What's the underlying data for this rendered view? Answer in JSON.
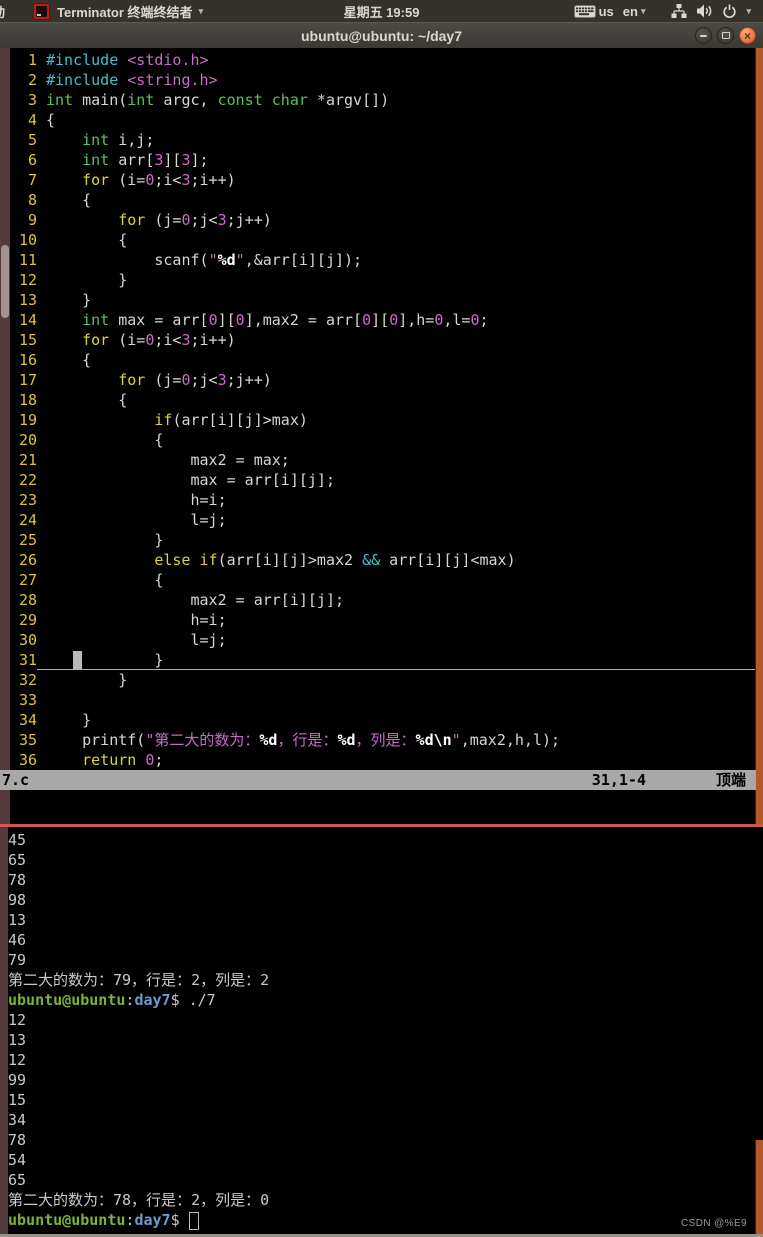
{
  "colors": {
    "panel_bg": "#35322b",
    "panel_text": "#dcd8cf",
    "titlebar_top": "#4c4a45",
    "titlebar_bottom": "#3b3935",
    "titlebar_text": "#dcd8cf",
    "term_bg": "#000000",
    "linenr": "#dcc535",
    "keyword": "#d8d33f",
    "type": "#52c45c",
    "preproc": "#3fc1cf",
    "string": "#c96bc8",
    "special": "#ffffff",
    "operator_cyan": "#3fc8c8",
    "plain": "#d6d6d6",
    "statusbar_bg": "#a8a8a8",
    "statusbar_text": "#000000",
    "cursor": "#b9b9b9",
    "divider_red": "#cf574d",
    "scroll_track": "#543a3c",
    "scroll_thumb_light": "#a29294",
    "scroll_thumb_orange": "#b5562c",
    "prompt_user": "#7cb335",
    "prompt_dir": "#6b9bd2",
    "output_text": "#c9c9c9",
    "watermark": "#9a9a9a"
  },
  "top_bar": {
    "clipped_text": "动",
    "app_menu": "Terminator 终端终结者",
    "menu_caret": "▾",
    "clock": "星期五 19:59",
    "keyboard_label": "us",
    "language_label": "en",
    "language_caret": "▾",
    "session_caret": "▾",
    "icons": [
      "keyboard-icon",
      "network-icon",
      "volume-icon",
      "power-icon"
    ]
  },
  "title_bar": {
    "title": "ubuntu@ubuntu: ~/day7",
    "close_glyph": "×"
  },
  "editor": {
    "status": {
      "file": "7.c",
      "ruler": "31,1-4",
      "position": "顶端"
    },
    "lines": [
      {
        "n": "1",
        "s": [
          [
            "pre",
            "#include"
          ],
          [
            "pl",
            " "
          ],
          [
            "str",
            "<stdio.h>"
          ]
        ]
      },
      {
        "n": "2",
        "s": [
          [
            "pre",
            "#include"
          ],
          [
            "pl",
            " "
          ],
          [
            "str",
            "<string.h>"
          ]
        ]
      },
      {
        "n": "3",
        "s": [
          [
            "typ",
            "int"
          ],
          [
            "pl",
            " main("
          ],
          [
            "typ",
            "int"
          ],
          [
            "pl",
            " argc, "
          ],
          [
            "typ",
            "const"
          ],
          [
            "pl",
            " "
          ],
          [
            "typ",
            "char"
          ],
          [
            "pl",
            " *argv[])"
          ]
        ]
      },
      {
        "n": "4",
        "s": [
          [
            "pl",
            "{"
          ]
        ]
      },
      {
        "n": "5",
        "s": [
          [
            "pl",
            "    "
          ],
          [
            "typ",
            "int"
          ],
          [
            "pl",
            " i,j;"
          ]
        ]
      },
      {
        "n": "6",
        "s": [
          [
            "pl",
            "    "
          ],
          [
            "typ",
            "int"
          ],
          [
            "pl",
            " arr["
          ],
          [
            "str",
            "3"
          ],
          [
            "pl",
            "]["
          ],
          [
            "str",
            "3"
          ],
          [
            "pl",
            "];"
          ]
        ]
      },
      {
        "n": "7",
        "s": [
          [
            "pl",
            "    "
          ],
          [
            "kw",
            "for"
          ],
          [
            "pl",
            " (i="
          ],
          [
            "str",
            "0"
          ],
          [
            "pl",
            ";i<"
          ],
          [
            "str",
            "3"
          ],
          [
            "pl",
            ";i++)"
          ]
        ]
      },
      {
        "n": "8",
        "s": [
          [
            "pl",
            "    {"
          ]
        ]
      },
      {
        "n": "9",
        "s": [
          [
            "pl",
            "        "
          ],
          [
            "kw",
            "for"
          ],
          [
            "pl",
            " (j="
          ],
          [
            "str",
            "0"
          ],
          [
            "pl",
            ";j<"
          ],
          [
            "str",
            "3"
          ],
          [
            "pl",
            ";j++)"
          ]
        ]
      },
      {
        "n": "10",
        "s": [
          [
            "pl",
            "        {"
          ]
        ]
      },
      {
        "n": "11",
        "s": [
          [
            "pl",
            "            scanf("
          ],
          [
            "str",
            "\""
          ],
          [
            "sp",
            "%d"
          ],
          [
            "str",
            "\""
          ],
          [
            "pl",
            ",&arr[i][j]);"
          ]
        ]
      },
      {
        "n": "12",
        "s": [
          [
            "pl",
            "        }"
          ]
        ]
      },
      {
        "n": "13",
        "s": [
          [
            "pl",
            "    }"
          ]
        ]
      },
      {
        "n": "14",
        "s": [
          [
            "pl",
            "    "
          ],
          [
            "typ",
            "int"
          ],
          [
            "pl",
            " max = arr["
          ],
          [
            "str",
            "0"
          ],
          [
            "pl",
            "]["
          ],
          [
            "str",
            "0"
          ],
          [
            "pl",
            "],max2 = arr["
          ],
          [
            "str",
            "0"
          ],
          [
            "pl",
            "]["
          ],
          [
            "str",
            "0"
          ],
          [
            "pl",
            "],h="
          ],
          [
            "str",
            "0"
          ],
          [
            "pl",
            ",l="
          ],
          [
            "str",
            "0"
          ],
          [
            "pl",
            ";"
          ]
        ]
      },
      {
        "n": "15",
        "s": [
          [
            "pl",
            "    "
          ],
          [
            "kw",
            "for"
          ],
          [
            "pl",
            " (i="
          ],
          [
            "str",
            "0"
          ],
          [
            "pl",
            ";i<"
          ],
          [
            "str",
            "3"
          ],
          [
            "pl",
            ";i++)"
          ]
        ]
      },
      {
        "n": "16",
        "s": [
          [
            "pl",
            "    {"
          ]
        ]
      },
      {
        "n": "17",
        "s": [
          [
            "pl",
            "        "
          ],
          [
            "kw",
            "for"
          ],
          [
            "pl",
            " (j="
          ],
          [
            "str",
            "0"
          ],
          [
            "pl",
            ";j<"
          ],
          [
            "str",
            "3"
          ],
          [
            "pl",
            ";j++)"
          ]
        ]
      },
      {
        "n": "18",
        "s": [
          [
            "pl",
            "        {"
          ]
        ]
      },
      {
        "n": "19",
        "s": [
          [
            "pl",
            "            "
          ],
          [
            "kw",
            "if"
          ],
          [
            "pl",
            "(arr[i][j]>max)"
          ]
        ]
      },
      {
        "n": "20",
        "s": [
          [
            "pl",
            "            {"
          ]
        ]
      },
      {
        "n": "21",
        "s": [
          [
            "pl",
            "                max2 = max;"
          ]
        ]
      },
      {
        "n": "22",
        "s": [
          [
            "pl",
            "                max = arr[i][j];"
          ]
        ]
      },
      {
        "n": "23",
        "s": [
          [
            "pl",
            "                h=i;"
          ]
        ]
      },
      {
        "n": "24",
        "s": [
          [
            "pl",
            "                l=j;"
          ]
        ]
      },
      {
        "n": "25",
        "s": [
          [
            "pl",
            "            }"
          ]
        ]
      },
      {
        "n": "26",
        "s": [
          [
            "pl",
            "            "
          ],
          [
            "kw",
            "else"
          ],
          [
            "pl",
            " "
          ],
          [
            "kw",
            "if"
          ],
          [
            "pl",
            "(arr[i][j]>max2 "
          ],
          [
            "opc",
            "&&"
          ],
          [
            "pl",
            " arr[i][j]<max)"
          ]
        ]
      },
      {
        "n": "27",
        "s": [
          [
            "pl",
            "            {"
          ]
        ]
      },
      {
        "n": "28",
        "s": [
          [
            "pl",
            "                max2 = arr[i][j];"
          ]
        ]
      },
      {
        "n": "29",
        "s": [
          [
            "pl",
            "                h=i;"
          ]
        ]
      },
      {
        "n": "30",
        "s": [
          [
            "pl",
            "                l=j;"
          ]
        ]
      },
      {
        "n": "31",
        "cls": "cursorline",
        "s": [
          [
            "pl",
            "   "
          ],
          [
            "cur",
            " "
          ],
          [
            "pl",
            "        }"
          ]
        ]
      },
      {
        "n": "32",
        "s": [
          [
            "pl",
            "        }"
          ]
        ]
      },
      {
        "n": "33",
        "s": []
      },
      {
        "n": "34",
        "s": [
          [
            "pl",
            "    }"
          ]
        ]
      },
      {
        "n": "35",
        "s": [
          [
            "pl",
            "    printf("
          ],
          [
            "str",
            "\"第二大的数为："
          ],
          [
            "sp",
            "%d"
          ],
          [
            "str",
            "，行是："
          ],
          [
            "sp",
            "%d"
          ],
          [
            "str",
            "，列是："
          ],
          [
            "sp",
            "%d"
          ],
          [
            "sp",
            "\\n"
          ],
          [
            "str",
            "\""
          ],
          [
            "pl",
            ",max2,h,l);"
          ]
        ]
      },
      {
        "n": "36",
        "s": [
          [
            "pl",
            "    "
          ],
          [
            "kw",
            "return"
          ],
          [
            "pl",
            " "
          ],
          [
            "str",
            "0"
          ],
          [
            "pl",
            ";"
          ]
        ]
      }
    ]
  },
  "terminal": {
    "lines": [
      {
        "s": [
          [
            "out",
            "45"
          ]
        ]
      },
      {
        "s": [
          [
            "out",
            "65"
          ]
        ]
      },
      {
        "s": [
          [
            "out",
            "78"
          ]
        ]
      },
      {
        "s": [
          [
            "out",
            "98"
          ]
        ]
      },
      {
        "s": [
          [
            "out",
            "13"
          ]
        ]
      },
      {
        "s": [
          [
            "out",
            "46"
          ]
        ]
      },
      {
        "s": [
          [
            "out",
            "79"
          ]
        ]
      },
      {
        "s": [
          [
            "out",
            "第二大的数为：79，行是：2，列是：2"
          ]
        ]
      },
      {
        "s": [
          [
            "g",
            "ubuntu@ubuntu"
          ],
          [
            "out",
            ":"
          ],
          [
            "b",
            "day7"
          ],
          [
            "out",
            "$ ./7"
          ]
        ]
      },
      {
        "s": [
          [
            "out",
            "12"
          ]
        ]
      },
      {
        "s": [
          [
            "out",
            "13"
          ]
        ]
      },
      {
        "s": [
          [
            "out",
            "12"
          ]
        ]
      },
      {
        "s": [
          [
            "out",
            "99"
          ]
        ]
      },
      {
        "s": [
          [
            "out",
            "15"
          ]
        ]
      },
      {
        "s": [
          [
            "out",
            "34"
          ]
        ]
      },
      {
        "s": [
          [
            "out",
            "78"
          ]
        ]
      },
      {
        "s": [
          [
            "out",
            "54"
          ]
        ]
      },
      {
        "s": [
          [
            "out",
            "65"
          ]
        ]
      },
      {
        "s": [
          [
            "out",
            "第二大的数为：78，行是：2，列是：0"
          ]
        ]
      },
      {
        "s": [
          [
            "g",
            "ubuntu@ubuntu"
          ],
          [
            "out",
            ":"
          ],
          [
            "b",
            "day7"
          ],
          [
            "out",
            "$ "
          ],
          [
            "hc",
            " "
          ]
        ]
      }
    ]
  },
  "watermark": "CSDN @%E9"
}
